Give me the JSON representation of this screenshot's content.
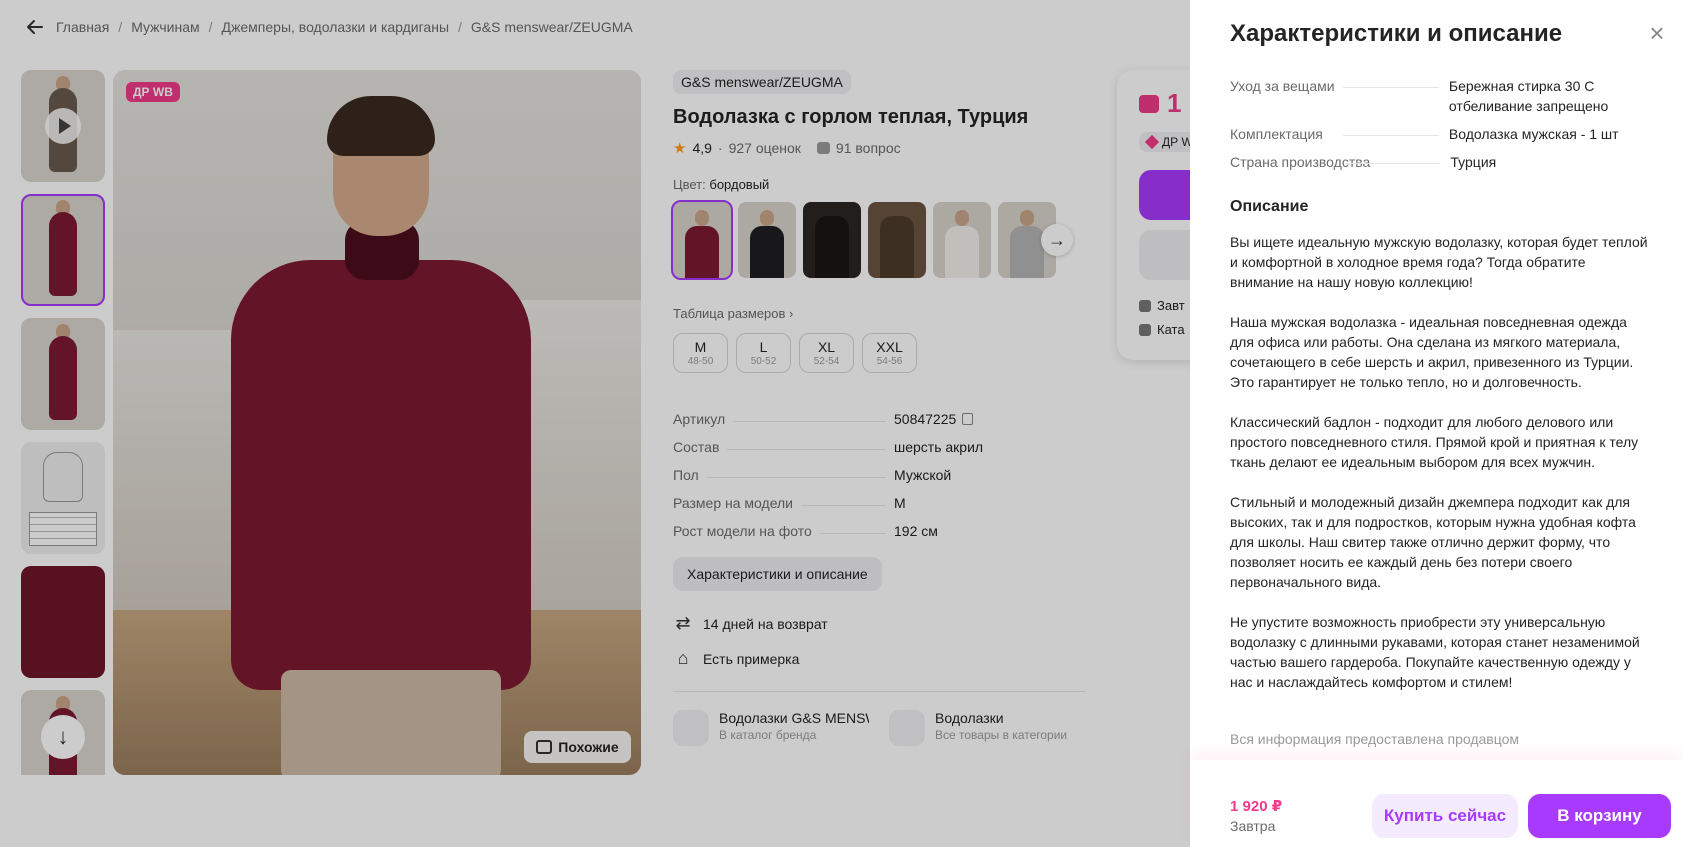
{
  "breadcrumb": {
    "items": [
      "Главная",
      "Мужчинам",
      "Джемперы, водолазки и кардиганы",
      "G&S menswear/ZEUGMA"
    ],
    "separator": "/"
  },
  "gallery": {
    "badge": "ДР WB",
    "similar_label": "Похожие"
  },
  "product": {
    "brand": "G&S menswear/ZEUGMA",
    "title": "Водолазка с горлом теплая, Турция",
    "rating": "4,9",
    "reviews": "927 оценок",
    "questions": "91 вопрос",
    "color_label": "Цвет:",
    "color_value": "бордовый",
    "size_table_label": "Таблица размеров",
    "sizes": [
      {
        "size": "M",
        "range": "48-50"
      },
      {
        "size": "L",
        "range": "50-52"
      },
      {
        "size": "XL",
        "range": "52-54"
      },
      {
        "size": "XXL",
        "range": "54-56"
      }
    ],
    "specs": [
      {
        "key": "Артикул",
        "value": "50847225"
      },
      {
        "key": "Состав",
        "value": "шерсть акрил"
      },
      {
        "key": "Пол",
        "value": "Мужской"
      },
      {
        "key": "Размер на модели",
        "value": "M"
      },
      {
        "key": "Рост модели на фото",
        "value": "192 см"
      }
    ],
    "characteristics_button": "Характеристики и описание",
    "features": [
      {
        "icon": "return-arrows-icon",
        "text": "14 дней на возврат"
      },
      {
        "icon": "hanger-icon",
        "text": "Есть примерка"
      }
    ],
    "catalog_links": [
      {
        "title": "Водолазки G&S MENSW",
        "subtitle": "В каталог бренда"
      },
      {
        "title": "Водолазки",
        "subtitle": "Все товары в категории"
      }
    ]
  },
  "buy_card": {
    "price_partial": "1",
    "chip_partial": "ДР W",
    "row1": "Завт",
    "row2": "Ката"
  },
  "panel": {
    "title": "Характеристики и описание",
    "specs": [
      {
        "key": "Уход за вещами",
        "value": "Бережная стирка 30 С отбеливание запрещено"
      },
      {
        "key": "Комплектация",
        "value": "Водолазка мужская - 1 шт"
      },
      {
        "key": "Страна производства",
        "value": "Турция"
      }
    ],
    "description_heading": "Описание",
    "description": [
      "Вы ищете идеальную мужскую водолазку, которая будет теплой и комфортной в холодное время года? Тогда обратите внимание на нашу новую коллекцию!",
      "Наша мужская водолазка - идеальная повседневная одежда для офиса или работы. Она сделана из мягкого материала, сочетающего в себе шерсть и акрил, привезенного из Турции. Это гарантирует не только тепло, но и долговечность.",
      "Классический бадлон - подходит для любого делового или простого повседневного стиля. Прямой крой и приятная к телу ткань делают ее идеальным выбором для всех мужчин.",
      "Стильный и молодежный дизайн джемпера подходит как для высоких, так и для подростков, которым нужна удобная кофта для школы. Наш свитер также отлично держит форму, что позволяет носить ее каждый день без потери своего первоначального вида.",
      "Не упустите возможность приобрести эту универсальную водолазку с длинными рукавами, которая станет незаменимой частью вашего гардероба. Покупайте качественную одежду у нас и наслаждайтесь комфортом и стилем!"
    ],
    "seller_note": "Вся информация предоставлена продавцом",
    "bottom": {
      "price": "1 920 ₽",
      "date": "Завтра",
      "buy_now": "Купить сейчас",
      "add_to_cart": "В корзину"
    }
  },
  "colors": {
    "accent": "#a73afd",
    "price": "#f23a8a",
    "sweater": "#7c1a30"
  }
}
